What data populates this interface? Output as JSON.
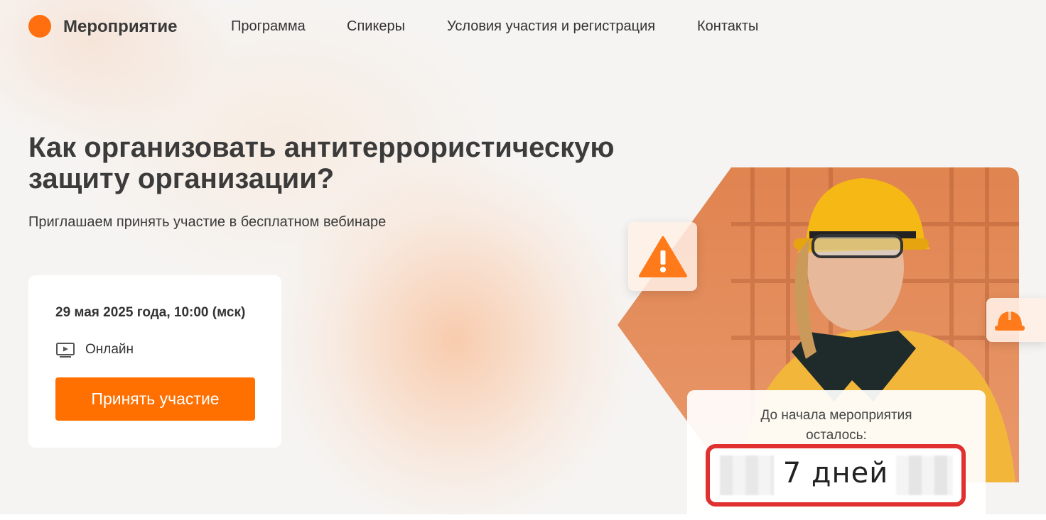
{
  "header": {
    "logo_text": "Мероприятие",
    "nav": [
      {
        "label": "Программа"
      },
      {
        "label": "Спикеры"
      },
      {
        "label": "Условия участия и регистрация"
      },
      {
        "label": "Контакты"
      }
    ]
  },
  "hero": {
    "title": "Как организовать антитеррористическую защиту организации?",
    "subtitle": "Приглашаем принять участие в бесплатном вебинаре"
  },
  "event_card": {
    "date": "29 мая 2025 года, 10:00 (мск)",
    "format": "Онлайн",
    "cta_label": "Принять участие"
  },
  "countdown": {
    "label": "До начала мероприятия осталось:",
    "value": "7 дней"
  },
  "colors": {
    "accent": "#ff7000",
    "highlight_border": "#e03030"
  },
  "icons": {
    "logo": "orange-circle",
    "format": "video-play-icon",
    "warning": "warning-triangle-icon",
    "helmet": "hard-hat-icon"
  }
}
